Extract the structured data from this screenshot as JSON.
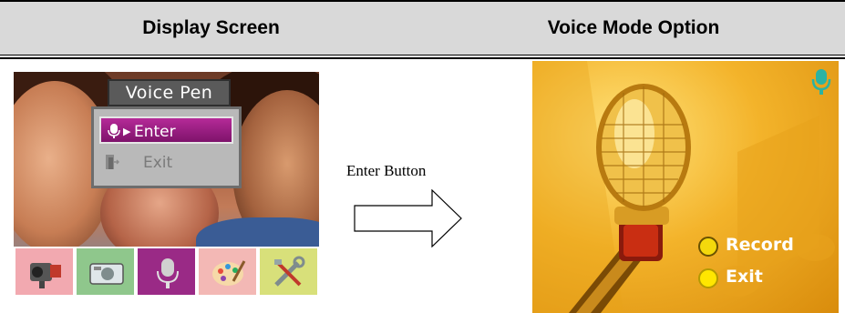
{
  "table": {
    "col_left_header": "Display Screen",
    "col_right_header": "Voice Mode Option"
  },
  "display_screen": {
    "menu_title": "Voice Pen",
    "menu_items": [
      {
        "label": "Enter",
        "selected": true,
        "icon": "microphone-icon"
      },
      {
        "label": "Exit",
        "selected": false,
        "icon": "exit-door-icon"
      }
    ],
    "mode_icons": [
      "video-camera-icon",
      "camera-icon",
      "microphone-icon",
      "palette-icon",
      "tools-icon"
    ],
    "active_mode": "microphone-icon"
  },
  "transition": {
    "label": "Enter Button",
    "icon": "right-arrow-icon"
  },
  "voice_mode_screen": {
    "status_icon": "microphone-icon",
    "options": [
      {
        "label": "Record",
        "icon": "record-button-icon"
      },
      {
        "label": "Exit",
        "icon": "yellow-circle-icon"
      }
    ],
    "colors": {
      "background": "#f3b32a",
      "selected_menu": "#9a2a86"
    }
  }
}
